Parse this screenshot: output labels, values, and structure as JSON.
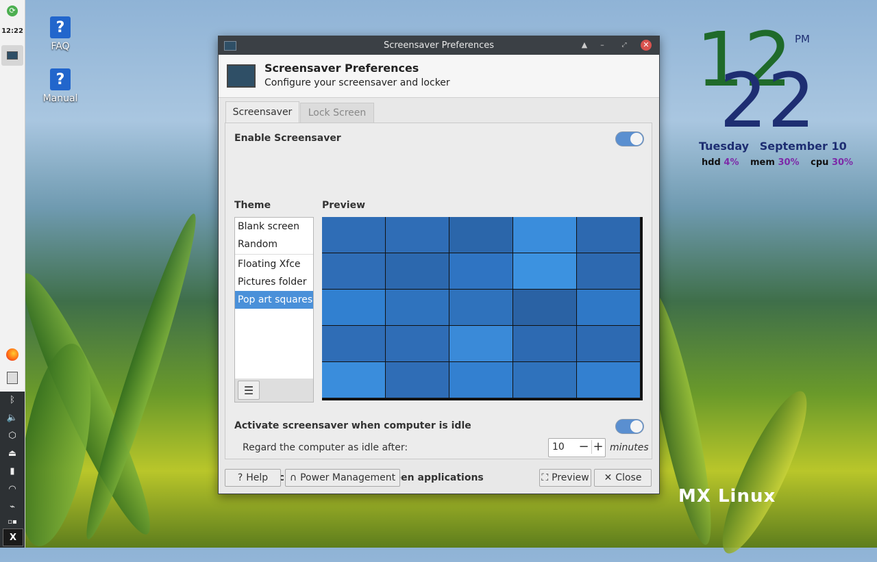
{
  "desktop": {
    "icons": [
      {
        "label": "FAQ",
        "glyph": "?"
      },
      {
        "label": "Manual",
        "glyph": "?"
      }
    ],
    "conky": {
      "hour": "12",
      "minute": "22",
      "ampm": "PM",
      "day": "Tuesday",
      "date": "September 10",
      "hdd_label": "hdd",
      "hdd_value": "4%",
      "mem_label": "mem",
      "mem_value": "30%",
      "cpu_label": "cpu",
      "cpu_value": "30%",
      "hour_color": "#1f6a2a",
      "minute_color": "#1e2e72"
    },
    "brand_logo": "MX Linux"
  },
  "panel": {
    "clock": "12:22",
    "icons": [
      "updater-icon",
      "window-icon",
      "firefox-icon",
      "files-icon",
      "bluetooth-icon",
      "volume-icon",
      "package-icon",
      "eject-icon",
      "battery-icon",
      "wifi-icon",
      "clipboard-icon",
      "desktop-icon",
      "mx-menu-icon"
    ]
  },
  "window": {
    "title": "Screensaver Preferences",
    "header_title": "Screensaver Preferences",
    "header_subtitle": "Configure your screensaver and locker",
    "tabs": [
      {
        "label": "Screensaver",
        "active": true
      },
      {
        "label": "Lock Screen",
        "active": false
      }
    ],
    "enable_screensaver_label": "Enable Screensaver",
    "enable_screensaver": true,
    "theme_heading": "Theme",
    "preview_heading": "Preview",
    "themes": [
      "Blank screen",
      "Random",
      "Floating Xfce",
      "Pictures folder",
      "Pop art squares"
    ],
    "selected_theme": "Pop art squares",
    "activate_idle_label": "Activate screensaver when computer is idle",
    "activate_idle": true,
    "idle_after_label": "Regard the computer as idle after:",
    "idle_after_value": "10",
    "idle_unit": "minutes",
    "inhibit_label": "Inhibit screensaver for fullscreen applications",
    "inhibit": false,
    "buttons": {
      "help": "Help",
      "power": "Power Management",
      "preview": "Preview",
      "close": "Close"
    },
    "preview_colors": [
      "#2f6db6",
      "#2f6db6",
      "#2b66aa",
      "#3a8ddc",
      "#2d69b0",
      "#2f6db6",
      "#2c68ae",
      "#2f74c2",
      "#3c92e0",
      "#2d69b0",
      "#3180d0",
      "#2f73be",
      "#2f72bc",
      "#2a62a4",
      "#2f78c6",
      "#2f6db6",
      "#2f6db6",
      "#3a8ad8",
      "#2d6ab2",
      "#2d6ab2",
      "#3a8ddc",
      "#2f6db6",
      "#3380d0",
      "#2f72bc",
      "#3380d0"
    ]
  }
}
